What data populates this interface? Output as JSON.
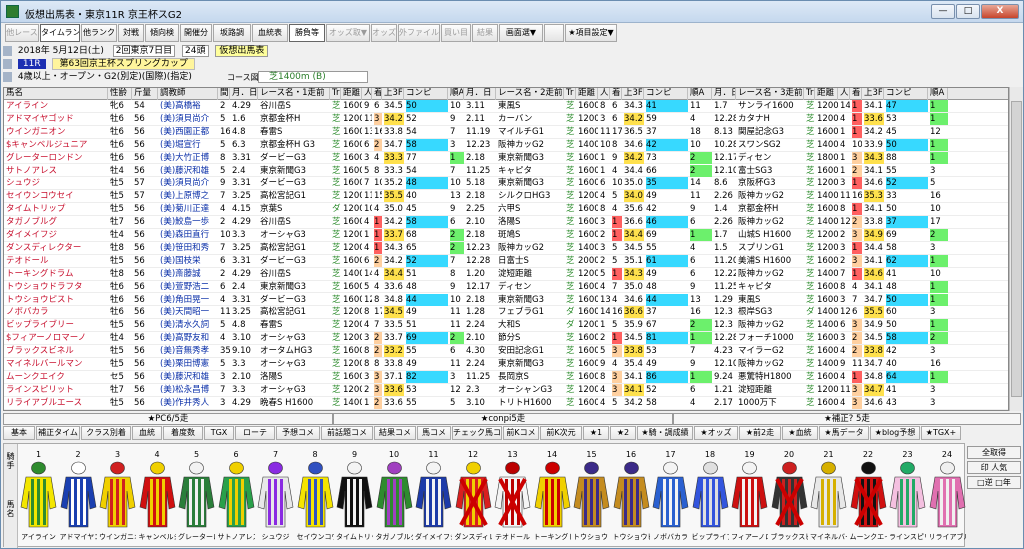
{
  "window": {
    "title": "仮想出馬表・東京11R 京王杯スG2",
    "min": "—",
    "max": "□",
    "close": "X"
  },
  "toolbar": [
    {
      "label": "他レース",
      "state": "dis"
    },
    {
      "label": "タイムランク",
      "state": "on"
    },
    {
      "label": "他ランク",
      "state": ""
    },
    {
      "label": "対戦",
      "state": ""
    },
    {
      "label": "傾向検",
      "state": ""
    },
    {
      "label": "開催分",
      "state": ""
    },
    {
      "label": "坂路調",
      "state": ""
    },
    {
      "label": "血統表",
      "state": ""
    },
    {
      "label": "勝負等",
      "state": "on"
    },
    {
      "label": "オッズ取▼",
      "state": "dis"
    },
    {
      "label": "オッズ",
      "state": "dis"
    },
    {
      "label": "外ファイル",
      "state": "dis"
    },
    {
      "label": "買い目",
      "state": "dis"
    },
    {
      "label": "結果",
      "state": "dis"
    },
    {
      "label": "画面選▼",
      "state": ""
    },
    {
      "label": "",
      "state": ""
    },
    {
      "label": "★項目設定▼",
      "state": ""
    }
  ],
  "info": {
    "date": "2018年 5月12日(土)",
    "kai": "2回東京7日目",
    "count": "24頭",
    "kasou": "仮想出馬表",
    "race_no": "11R",
    "race_name": "第63回京王杯スプリングカップ",
    "cond": "4歳以上・オープン・G2(別定)(国際)(指定)",
    "course_label": "コース図",
    "course": "芝1400m (B)"
  },
  "grid": {
    "headers": [
      "馬名",
      "性齢",
      "斤量",
      "調教師",
      "間",
      "月．日",
      "レース名・1走前",
      "Tr",
      "距離",
      "人",
      "着",
      "上3F",
      "コンピ",
      "順A",
      "月．日",
      "レース名・2走前",
      "Tr",
      "距離",
      "人",
      "着",
      "上3F",
      "コンピ",
      "順A",
      "月．日",
      "レース名・3走前",
      "Tr",
      "距離",
      "人",
      "着",
      "上3F",
      "コンピ",
      "順A"
    ],
    "rows": [
      [
        "アイライン",
        "牝6",
        "54",
        "(美)高橋裕",
        "2",
        "4.29",
        "谷川岳S",
        "芝",
        "1600",
        "9",
        "6",
        "34.5",
        "50",
        "10",
        "3.11",
        "東風S",
        "芝",
        "1600",
        "8",
        "6",
        "34.3",
        "41",
        "11",
        "1.7",
        "サンライ1600",
        "芝",
        "1200",
        "14",
        "1",
        "34.1",
        "47",
        "1"
      ],
      [
        "アドマイヤゴッド",
        "牡6",
        "56",
        "(美)須貝尚介",
        "5",
        "1.6",
        "京都金杯H",
        "芝",
        "1200",
        "11",
        "3",
        "34.2",
        "52",
        "9",
        "2.11",
        "カーバン",
        "芝",
        "1200",
        "3",
        "6",
        "34.2",
        "59",
        "4",
        "12.28",
        "カタナH",
        "芝",
        "1200",
        "4",
        "1",
        "33.6",
        "53",
        "1"
      ],
      [
        "ウインガニオン",
        "牡6",
        "56",
        "(美)西園正都",
        "16",
        "4.8",
        "春雷S",
        "芝",
        "1600",
        "13",
        "16",
        "33.8",
        "54",
        "7",
        "11.19",
        "マイルチG1",
        "芝",
        "1600",
        "11",
        "17",
        "36.5",
        "37",
        "18",
        "8.13",
        "関屋記念G3",
        "芝",
        "1600",
        "1",
        "1",
        "34.2",
        "45",
        "12"
      ],
      [
        "$キャンベルジュニア",
        "牡6",
        "56",
        "(美)堀宣行",
        "5",
        "6.3",
        "京都金杯H G3",
        "芝",
        "1600",
        "6",
        "2",
        "34.7",
        "58",
        "3",
        "12.23",
        "阪神カッG2",
        "芝",
        "1400",
        "10",
        "8",
        "34.6",
        "42",
        "10",
        "10.28",
        "スワンSG2",
        "芝",
        "1400",
        "4",
        "10",
        "33.9",
        "50",
        "1"
      ],
      [
        "グレーターロンドン",
        "牡6",
        "56",
        "(美)大竹正博",
        "8",
        "3.31",
        "ダービーG3",
        "芝",
        "1600",
        "3",
        "4",
        "33.3",
        "77",
        "1",
        "2.18",
        "東京新聞G3",
        "芝",
        "1600",
        "1",
        "9",
        "34.2",
        "73",
        "2",
        "12.17",
        "ディセン",
        "芝",
        "1800",
        "1",
        "3",
        "34.3",
        "88",
        "1"
      ],
      [
        "サトノアレス",
        "牡4",
        "56",
        "(美)藤沢和雄",
        "5",
        "2.4",
        "東京新聞G3",
        "芝",
        "1600",
        "5",
        "8",
        "33.3",
        "54",
        "7",
        "11.25",
        "キャピタ",
        "芝",
        "1600",
        "1",
        "4",
        "34.4",
        "66",
        "2",
        "12.10",
        "富士SG3",
        "芝",
        "1600",
        "1",
        "2",
        "34.1",
        "55",
        "3"
      ],
      [
        "シュウジ",
        "牡5",
        "57",
        "(美)須貝尚介",
        "9",
        "3.31",
        "ダービーG3",
        "芝",
        "1600",
        "7",
        "10",
        "35.2",
        "48",
        "10",
        "5.18",
        "東京新聞G3",
        "芝",
        "1600",
        "6",
        "10",
        "35.0",
        "35",
        "14",
        "8.6",
        "京阪杯G3",
        "芝",
        "1200",
        "3",
        "1",
        "34.6",
        "52",
        "5"
      ],
      [
        "セイウンコウセイ",
        "牡5",
        "57",
        "(美)上原博之",
        "7",
        "3.25",
        "高松宮記G1",
        "芝",
        "1200",
        "11",
        "15",
        "35.5",
        "40",
        "13",
        "2.18",
        "シルクロHG3",
        "芝",
        "1200",
        "4",
        "5",
        "34.0",
        "49",
        "11",
        "2.26",
        "阪神カッG2",
        "芝",
        "1400",
        "11",
        "16",
        "35.3",
        "33",
        "16"
      ],
      [
        "タイムトリップ",
        "牡5",
        "56",
        "(美)菊川正達",
        "4",
        "4.15",
        "京葉S",
        "ダ",
        "1200",
        "10",
        "4",
        "35.0",
        "45",
        "9",
        "2.25",
        "六甲S",
        "芝",
        "1600",
        "8",
        "4",
        "35.6",
        "42",
        "9",
        "1.4",
        "京都金杯H",
        "芝",
        "1600",
        "8",
        "1",
        "34.1",
        "50",
        "10"
      ],
      [
        "タガノブルグ",
        "牡7",
        "56",
        "(美)鮫島一歩",
        "2",
        "4.29",
        "谷川岳S",
        "芝",
        "1600",
        "4",
        "1",
        "34.2",
        "58",
        "6",
        "2.10",
        "洛陽S",
        "芝",
        "1600",
        "3",
        "1",
        "36.6",
        "46",
        "6",
        "2.26",
        "阪神カッG2",
        "芝",
        "1400",
        "12",
        "2",
        "33.8",
        "37",
        "17"
      ],
      [
        "ダイメイフジ",
        "牡4",
        "56",
        "(美)森田直行",
        "10",
        "3.3",
        "オーシャG3",
        "芝",
        "1200",
        "1",
        "1",
        "33.7",
        "68",
        "2",
        "2.18",
        "斑鳩S",
        "芝",
        "1600",
        "2",
        "1",
        "34.4",
        "69",
        "1",
        "1.7",
        "山城S H1600",
        "芝",
        "1200",
        "2",
        "3",
        "34.9",
        "69",
        "2"
      ],
      [
        "ダンスディレクター",
        "牡8",
        "56",
        "(美)笹田和秀",
        "7",
        "3.25",
        "高松宮記G1",
        "芝",
        "1200",
        "4",
        "1",
        "34.3",
        "65",
        "2",
        "12.23",
        "阪神カッG2",
        "芝",
        "1400",
        "3",
        "5",
        "34.5",
        "55",
        "4",
        "1.5",
        "スプリンG1",
        "芝",
        "1200",
        "3",
        "1",
        "34.4",
        "58",
        "3"
      ],
      [
        "テオドール",
        "牡5",
        "56",
        "(美)国枝栄",
        "6",
        "3.31",
        "ダービーG3",
        "芝",
        "1600",
        "6",
        "2",
        "34.2",
        "52",
        "7",
        "12.28",
        "日富士S",
        "芝",
        "2000",
        "2",
        "5",
        "35.1",
        "61",
        "6",
        "11.20",
        "美浦S H1600",
        "芝",
        "1600",
        "2",
        "3",
        "34.1",
        "62",
        "1"
      ],
      [
        "トーキングドラム",
        "牡8",
        "56",
        "(美)斎藤誠",
        "2",
        "4.29",
        "谷川岳S",
        "芝",
        "1400",
        "14",
        "4",
        "34.4",
        "51",
        "8",
        "1.20",
        "淀短距離",
        "芝",
        "1200",
        "5",
        "1",
        "34.3",
        "49",
        "6",
        "12.22",
        "阪神カッG2",
        "芝",
        "1400",
        "7",
        "1",
        "34.6",
        "41",
        "10"
      ],
      [
        "トウショウドラフタ",
        "牡6",
        "56",
        "(美)萱野浩二",
        "6",
        "2.4",
        "東京新聞G3",
        "芝",
        "1600",
        "5",
        "4",
        "33.6",
        "48",
        "9",
        "12.17",
        "ディセン",
        "芝",
        "1600",
        "4",
        "7",
        "35.0",
        "48",
        "9",
        "11.25",
        "キャピタ",
        "芝",
        "1600",
        "8",
        "4",
        "34.1",
        "48",
        "1"
      ],
      [
        "トウショウピスト",
        "牡6",
        "56",
        "(美)角田晃一",
        "4",
        "3.31",
        "ダービーG3",
        "芝",
        "1600",
        "12",
        "8",
        "34.8",
        "44",
        "10",
        "2.18",
        "東京新聞G3",
        "芝",
        "1600",
        "13",
        "4",
        "34.6",
        "44",
        "13",
        "1.29",
        "東風S",
        "芝",
        "1600",
        "3",
        "7",
        "34.7",
        "50",
        "1"
      ],
      [
        "ノボバカラ",
        "牡6",
        "56",
        "(美)天間昭一",
        "11",
        "3.25",
        "高松宮記G1",
        "芝",
        "1200",
        "8",
        "17",
        "34.5",
        "49",
        "11",
        "1.28",
        "フェブラG1",
        "ダ",
        "1600",
        "14",
        "16",
        "36.6",
        "37",
        "16",
        "12.3",
        "根岸SG3",
        "ダ",
        "1400",
        "12",
        "6",
        "35.5",
        "60",
        "3"
      ],
      [
        "ビップライブリー",
        "牡5",
        "56",
        "(美)清水久詞",
        "5",
        "4.8",
        "春雷S",
        "芝",
        "1200",
        "4",
        "7",
        "33.5",
        "51",
        "11",
        "2.24",
        "大和S",
        "ダ",
        "1200",
        "1",
        "5",
        "35.9",
        "67",
        "2",
        "12.3",
        "阪神カッG2",
        "芝",
        "1400",
        "6",
        "3",
        "34.9",
        "50",
        "1"
      ],
      [
        "$フィアーノロマーノ",
        "牡4",
        "56",
        "(美)高野友和",
        "4",
        "3.10",
        "オーシャG3",
        "芝",
        "1200",
        "3",
        "2",
        "33.7",
        "69",
        "2",
        "2.10",
        "節分S",
        "芝",
        "1600",
        "2",
        "1",
        "34.5",
        "81",
        "1",
        "12.28",
        "フォーチ1000",
        "芝",
        "1600",
        "3",
        "2",
        "34.5",
        "58",
        "2"
      ],
      [
        "ブラックスビネル",
        "牡5",
        "56",
        "(美)音無秀孝",
        "35",
        "9.10",
        "オータムHG3",
        "芝",
        "1600",
        "8",
        "2",
        "33.2",
        "55",
        "6",
        "4.30",
        "安田記念G1",
        "芝",
        "1600",
        "5",
        "3",
        "33.8",
        "53",
        "7",
        "4.23",
        "マイラーG2",
        "芝",
        "1600",
        "4",
        "2",
        "33.8",
        "42",
        "3"
      ],
      [
        "マイネルバールマン",
        "牡5",
        "56",
        "(美)栗田博憲",
        "5",
        "3.3",
        "オーシャG3",
        "芝",
        "1200",
        "8",
        "8",
        "33.8",
        "49",
        "11",
        "2.24",
        "東京新聞G3",
        "芝",
        "1600",
        "9",
        "4",
        "35.4",
        "49",
        "9",
        "12.10",
        "阪神カッG2",
        "芝",
        "1400",
        "9",
        "11",
        "34.7",
        "40",
        "16"
      ],
      [
        "ムーンクエイク",
        "セ5",
        "56",
        "(美)藤沢和雄",
        "3",
        "2.10",
        "洛陽S",
        "芝",
        "1600",
        "3",
        "3",
        "37.1",
        "82",
        "3",
        "11.25",
        "長岡京S",
        "芝",
        "1600",
        "8",
        "3",
        "34.1",
        "86",
        "1",
        "9.24",
        "悪驚特H1800",
        "芝",
        "1600",
        "4",
        "1",
        "34.8",
        "64",
        "1"
      ],
      [
        "ラインスピリット",
        "牡7",
        "56",
        "(美)松永昌博",
        "7",
        "3.3",
        "オーシャG3",
        "芝",
        "1200",
        "2",
        "3",
        "33.6",
        "53",
        "12",
        "2.3",
        "オーシャンG3",
        "芝",
        "1200",
        "4",
        "3",
        "34.1",
        "52",
        "6",
        "1.21",
        "淀短距離",
        "芝",
        "1200",
        "11",
        "3",
        "34.7",
        "41",
        "3"
      ],
      [
        "リライアブルエース",
        "牡5",
        "56",
        "(美)作井秀人",
        "3",
        "4.29",
        "晩春S H1600",
        "芝",
        "1400",
        "1",
        "2",
        "33.6",
        "55",
        "5",
        "3.10",
        "トリトH1600",
        "芝",
        "1600",
        "4",
        "5",
        "34.2",
        "58",
        "4",
        "2.17",
        "1000万下",
        "芝",
        "1600",
        "4",
        "3",
        "34.6",
        "43",
        "3"
      ]
    ]
  },
  "sections": [
    "★PC6/5走",
    "★conpi5走",
    "★補正? 5走"
  ],
  "buttons": [
    "基本",
    "補正タイム",
    "クラス別着",
    "血統",
    "着度数",
    "TGX",
    "ローテ",
    "予想コメ",
    "前話題コメ",
    "結果コメ",
    "馬コメ",
    "チェック馬コメ",
    "前Kコメ",
    "前K次元",
    "★1",
    "★2",
    "★騎・調成績",
    "★オッズ",
    "★前2走",
    "★血統",
    "★馬データ",
    "★blog予想",
    "★TGX+"
  ],
  "silks_side": "騎手\n馬名",
  "silks": [
    {
      "n": "1",
      "name": "アイライン",
      "c1": "#f3e600",
      "c2": "#2e8b2e",
      "x": false
    },
    {
      "n": "2",
      "name": "アドマイヤゴ",
      "c1": "#1a3fb0",
      "c2": "#ffffff",
      "x": false
    },
    {
      "n": "3",
      "name": "ウインガニオ",
      "c1": "#f0d000",
      "c2": "#d02020",
      "x": false
    },
    {
      "n": "4",
      "name": "キャンベルジ",
      "c1": "#d01010",
      "c2": "#f0d000",
      "x": false
    },
    {
      "n": "5",
      "name": "グレーターロ",
      "c1": "#2a7e3a",
      "c2": "#f2f2f2",
      "x": false
    },
    {
      "n": "6",
      "name": "サトノアレス",
      "c1": "#2aa04a",
      "c2": "#f0d000",
      "x": false
    },
    {
      "n": "7",
      "name": "シュウジ",
      "c1": "#e8e8e8",
      "c2": "#8a2be2",
      "x": false
    },
    {
      "n": "8",
      "name": "セイウンコウ",
      "c1": "#f5e400",
      "c2": "#3050c0",
      "x": false
    },
    {
      "n": "9",
      "name": "タイムトリッ",
      "c1": "#111111",
      "c2": "#f4f4f4",
      "x": false
    },
    {
      "n": "10",
      "name": "タガノブルグ",
      "c1": "#2e8b2e",
      "c2": "#a040c0",
      "x": false
    },
    {
      "n": "11",
      "name": "ダイメイフジ",
      "c1": "#1d3ba8",
      "c2": "#f4f4f4",
      "x": false
    },
    {
      "n": "12",
      "name": "ダンスディレ",
      "c1": "#d82020",
      "c2": "#f0d000",
      "x": true
    },
    {
      "n": "13",
      "name": "テオドール",
      "c1": "#f4f4f4",
      "c2": "#bb0000",
      "x": true
    },
    {
      "n": "14",
      "name": "トーキングド",
      "c1": "#f0d000",
      "c2": "#cc0000",
      "x": false
    },
    {
      "n": "15",
      "name": "トウショウド",
      "c1": "#c48c20",
      "c2": "#3b2a88",
      "x": false
    },
    {
      "n": "16",
      "name": "トウショウピ",
      "c1": "#c48c20",
      "c2": "#3b2a88",
      "x": false
    },
    {
      "n": "17",
      "name": "ノボバカラ",
      "c1": "#2a60d0",
      "c2": "#f4f4f4",
      "x": false
    },
    {
      "n": "18",
      "name": "ビップライブ",
      "c1": "#3355dd",
      "c2": "#e0e0e0",
      "x": false
    },
    {
      "n": "19",
      "name": "フィアーノロ",
      "c1": "#cc1010",
      "c2": "#f4f4f4",
      "x": false
    },
    {
      "n": "20",
      "name": "ブラックスピ",
      "c1": "#333333",
      "c2": "#cc2020",
      "x": true
    },
    {
      "n": "21",
      "name": "マイネルバー",
      "c1": "#e8e8e8",
      "c2": "#d6b000",
      "x": false
    },
    {
      "n": "22",
      "name": "ムーンクエイ",
      "c1": "#d01010",
      "c2": "#111111",
      "x": true
    },
    {
      "n": "23",
      "name": "ラインスピリ",
      "c1": "#f4c0e0",
      "c2": "#22aa66",
      "x": false
    },
    {
      "n": "24",
      "name": "リライアブル",
      "c1": "#e070b0",
      "c2": "#f0f0f0",
      "x": false
    }
  ],
  "rightpanel": [
    "全取得",
    "印 人気",
    "□逆 □年"
  ]
}
